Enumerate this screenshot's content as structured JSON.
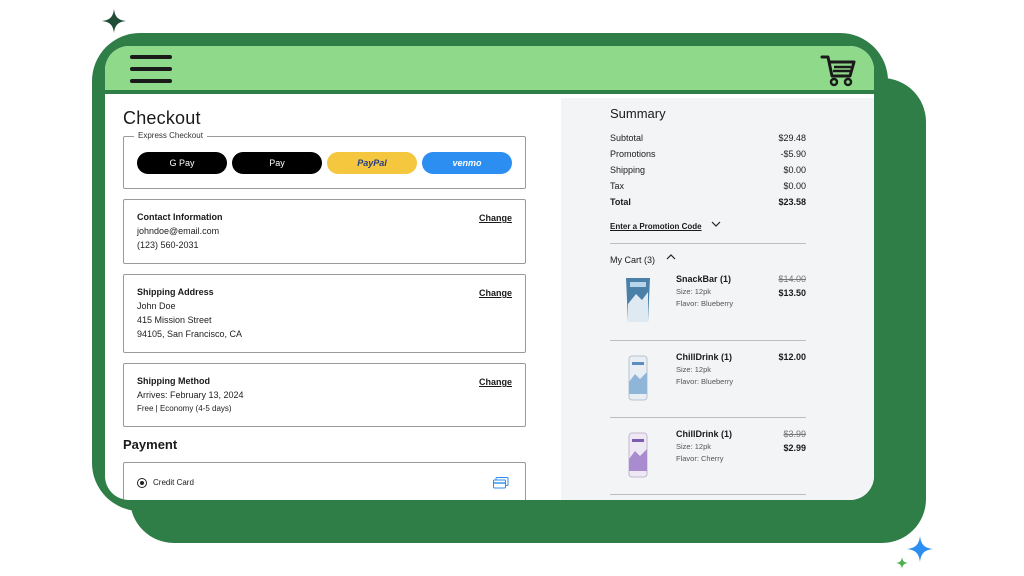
{
  "colors": {
    "brand_green": "#2f7d47",
    "header_green": "#8fd98a",
    "paypal_yellow": "#f5c73e",
    "venmo_blue": "#2c8ef0"
  },
  "header": {
    "menu_icon": "hamburger-icon",
    "cart_icon": "cart-icon"
  },
  "checkout": {
    "title": "Checkout",
    "express": {
      "legend": "Express Checkout",
      "gpay": "G Pay",
      "applepay": " Pay",
      "paypal": "PayPal",
      "venmo": "venmo"
    },
    "contact": {
      "title": "Contact Information",
      "email": "johndoe@email.com",
      "phone": "(123) 560-2031",
      "change": "Change"
    },
    "shipping_address": {
      "title": "Shipping Address",
      "name": "John Doe",
      "street": "415 Mission Street",
      "city": "94105, San Francisco, CA",
      "change": "Change"
    },
    "shipping_method": {
      "title": "Shipping Method",
      "arrives": "Arrives: February 13, 2024",
      "detail": "Free | Economy (4-5 days)",
      "change": "Change"
    },
    "payment": {
      "title": "Payment",
      "option": "Credit Card",
      "icon": "credit-card-icon"
    }
  },
  "summary": {
    "title": "Summary",
    "rows": [
      {
        "label": "Subtotal",
        "value": "$29.48"
      },
      {
        "label": "Promotions",
        "value": "-$5.90"
      },
      {
        "label": "Shipping",
        "value": "$0.00"
      },
      {
        "label": "Tax",
        "value": "$0.00"
      }
    ],
    "total": {
      "label": "Total",
      "value": "$23.58"
    },
    "promo_link": "Enter a Promotion Code",
    "cart_label": "My Cart (3)",
    "items": [
      {
        "name": "SnackBar (1)",
        "size": "Size: 12pk",
        "flavor": "Flavor: Blueberry",
        "old_price": "$14.00",
        "price": "$13.50"
      },
      {
        "name": "ChillDrink (1)",
        "size": "Size: 12pk",
        "flavor": "Flavor: Blueberry",
        "old_price": "",
        "price": "$12.00"
      },
      {
        "name": "ChillDrink (1)",
        "size": "Size: 12pk",
        "flavor": "Flavor: Cherry",
        "old_price": "$3.99",
        "price": "$2.99"
      }
    ]
  }
}
